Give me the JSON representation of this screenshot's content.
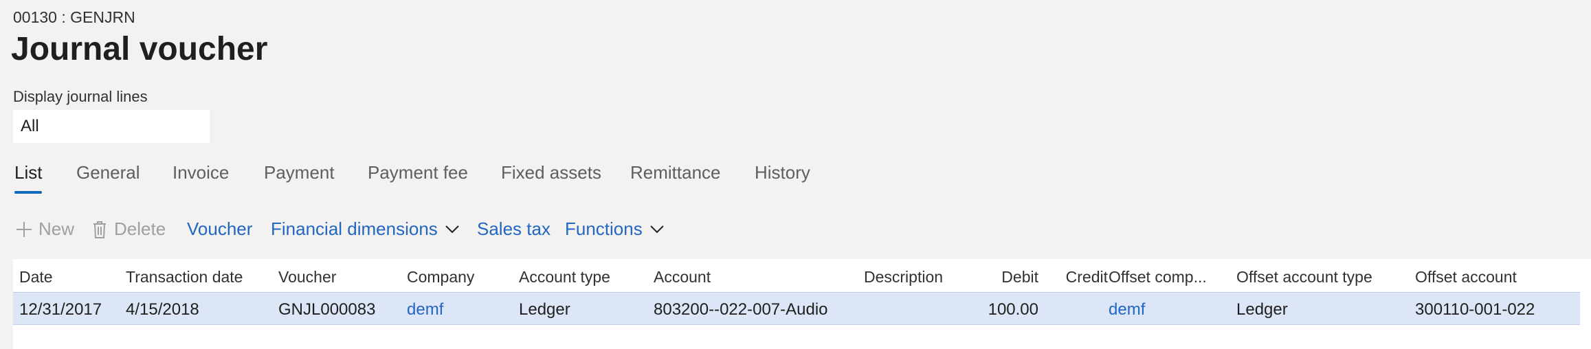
{
  "header": {
    "caption": "00130 : GENJRN",
    "title": "Journal voucher"
  },
  "filter": {
    "label": "Display journal lines",
    "value": "All"
  },
  "tabs": [
    {
      "label": "List",
      "active": true
    },
    {
      "label": "General"
    },
    {
      "label": "Invoice"
    },
    {
      "label": "Payment"
    },
    {
      "label": "Payment fee"
    },
    {
      "label": "Fixed assets"
    },
    {
      "label": "Remittance"
    },
    {
      "label": "History"
    }
  ],
  "toolbar": {
    "new_label": "New",
    "delete_label": "Delete",
    "voucher_label": "Voucher",
    "financial_dimensions_label": "Financial dimensions",
    "sales_tax_label": "Sales tax",
    "functions_label": "Functions"
  },
  "table": {
    "columns": [
      "Date",
      "Transaction date",
      "Voucher",
      "Company",
      "Account type",
      "Account",
      "Description",
      "Debit",
      "Credit",
      "Offset comp...",
      "Offset account type",
      "Offset account"
    ],
    "rows": [
      {
        "date": "12/31/2017",
        "transaction_date": "4/15/2018",
        "voucher": "GNJL000083",
        "company": "demf",
        "account_type": "Ledger",
        "account": "803200--022-007-Audio",
        "description": "",
        "debit": "100.00",
        "credit": "",
        "offset_company": "demf",
        "offset_account_type": "Ledger",
        "offset_account": "300110-001-022"
      }
    ]
  },
  "colors": {
    "accent": "#0f6cbd",
    "link": "#2266c4",
    "selected_row": "#dce6f7",
    "background": "#f3f2f1"
  },
  "icons": {
    "new": "plus-icon",
    "delete": "trash-icon",
    "dropdown": "chevron-down-icon"
  }
}
